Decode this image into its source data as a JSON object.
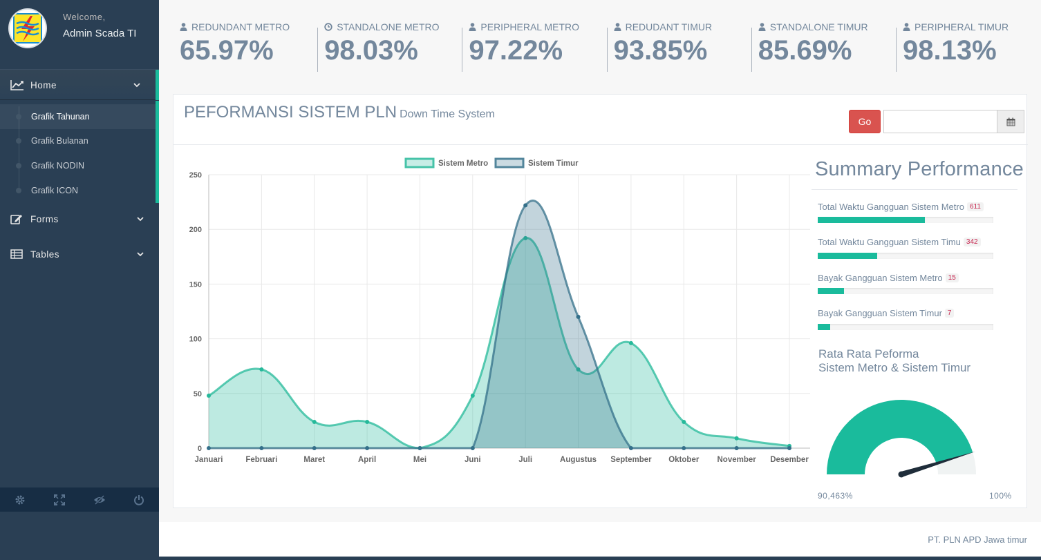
{
  "profile": {
    "welcome": "Welcome,",
    "username": "Admin Scada TI"
  },
  "nav": {
    "home": "Home",
    "submenu": [
      "Grafik Tahunan",
      "Grafik Bulanan",
      "Grafik NODIN",
      "Grafik ICON"
    ],
    "forms": "Forms",
    "tables": "Tables"
  },
  "tiles": [
    {
      "label": "REDUNDANT METRO",
      "value": "65.97%",
      "icon": "user-icon"
    },
    {
      "label": "STANDALONE METRO",
      "value": "98.03%",
      "icon": "clock-icon"
    },
    {
      "label": "PERIPHERAL METRO",
      "value": "97.22%",
      "icon": "user-icon"
    },
    {
      "label": "REDUDANT TIMUR",
      "value": "93.85%",
      "icon": "user-icon"
    },
    {
      "label": "STANDALONE TIMUR",
      "value": "85.69%",
      "icon": "user-icon"
    },
    {
      "label": "PERIPHERAL TIMUR",
      "value": "98.13%",
      "icon": "user-icon"
    }
  ],
  "panel": {
    "title": "PEFORMANSI SISTEM PLN",
    "subtitle": "Down Time System",
    "go_label": "Go",
    "date_value": ""
  },
  "chart_data": {
    "type": "area",
    "categories": [
      "Januari",
      "Februari",
      "Maret",
      "April",
      "Mei",
      "Juni",
      "Juli",
      "Augustus",
      "September",
      "Oktober",
      "November",
      "Desember"
    ],
    "series": [
      {
        "name": "Sistem Metro",
        "values": [
          48,
          72,
          24,
          24,
          0,
          48,
          192,
          72,
          96,
          24,
          9,
          2
        ],
        "color": "#26b99a"
      },
      {
        "name": "Sistem Timur",
        "values": [
          0,
          0,
          0,
          0,
          0,
          0,
          222,
          120,
          0,
          0,
          0,
          0
        ],
        "color": "#34708a"
      }
    ],
    "ylim": [
      0,
      250
    ],
    "yticks": [
      0,
      50,
      100,
      150,
      200,
      250
    ],
    "grid": true,
    "legend": "top-center"
  },
  "summary": {
    "title": "Summary Performance",
    "items": [
      {
        "label": "Total Waktu Gangguan Sistem Metro",
        "badge": "611",
        "fraction": 0.61
      },
      {
        "label": "Total Waktu Gangguan Sistem Timu",
        "badge": "342",
        "fraction": 0.34
      },
      {
        "label": "Bayak Gangguan Sistem Metro",
        "badge": "15",
        "fraction": 0.15
      },
      {
        "label": "Bayak Gangguan Sistem Timur",
        "badge": "7",
        "fraction": 0.07
      }
    ],
    "gauge_title_1": "Rata Rata Peforma",
    "gauge_title_2": "Sistem Metro & Sistem Timur",
    "gauge_value": 90.463,
    "gauge_min_label": "90,463%",
    "gauge_max_label": "100%"
  },
  "footer": {
    "text": "PT. PLN APD Jawa timur"
  },
  "colors": {
    "accent": "#1abb9c",
    "sidebar": "#2a3f54",
    "danger": "#d9534f"
  }
}
